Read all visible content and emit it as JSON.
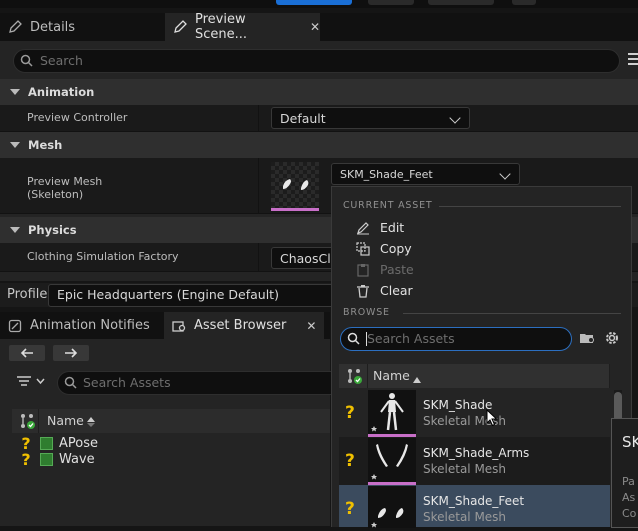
{
  "tabs": {
    "details": "Details",
    "preview_scene": "Preview Scene...",
    "close_glyph": "✕"
  },
  "details_search_placeholder": "Search",
  "sections": {
    "animation": "Animation",
    "mesh": "Mesh",
    "physics": "Physics"
  },
  "properties": {
    "preview_controller_label": "Preview Controller",
    "preview_controller_value": "Default",
    "preview_mesh_label_1": "Preview Mesh",
    "preview_mesh_label_2": "(Skeleton)",
    "preview_mesh_value": "SKM_Shade_Feet",
    "clothing_label": "Clothing Simulation Factory",
    "clothing_value": "ChaosClo"
  },
  "profile": {
    "label": "Profile",
    "value": "Epic Headquarters (Engine Default)"
  },
  "bottom_tabs": {
    "anim_notifies": "Animation Notifies",
    "asset_browser": "Asset Browser"
  },
  "asset_browser": {
    "search_placeholder": "Search Assets",
    "column_name": "Name",
    "items": [
      "APose",
      "Wave"
    ]
  },
  "dropdown": {
    "current_asset_header": "CURRENT ASSET",
    "browse_header": "BROWSE",
    "edit": "Edit",
    "copy": "Copy",
    "paste": "Paste",
    "clear": "Clear",
    "search_placeholder": "Search Assets",
    "column_name": "Name",
    "assets": [
      {
        "name": "SKM_Shade",
        "type": "Skeletal Mesh"
      },
      {
        "name": "SKM_Shade_Arms",
        "type": "Skeletal Mesh"
      },
      {
        "name": "SKM_Shade_Feet",
        "type": "Skeletal Mesh"
      }
    ]
  },
  "tooltip": {
    "title": "SK",
    "lines": [
      "Pa",
      "As",
      "Co"
    ]
  },
  "colors": {
    "accent_blue": "#1a6fd6",
    "selected_row": "#3b4b5e",
    "mesh_underline": "#c86fc8",
    "unknown_icon": "#f0c000"
  }
}
